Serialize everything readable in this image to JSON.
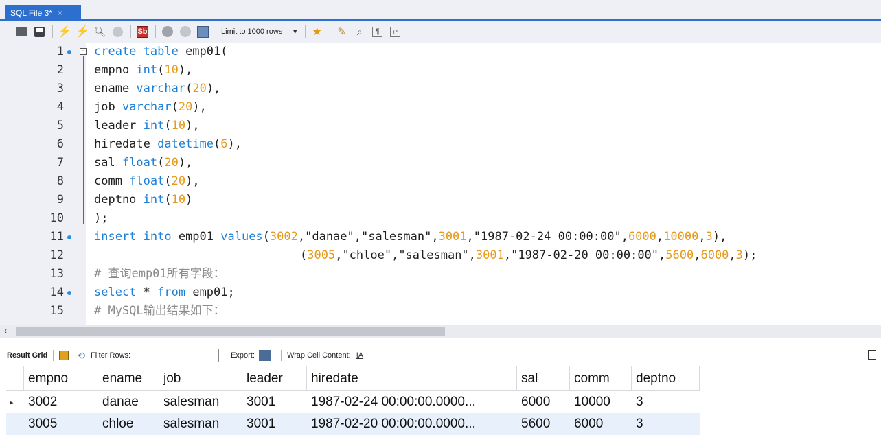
{
  "tab": {
    "title": "SQL File 3*",
    "close": "×"
  },
  "toolbar": {
    "limit_label": "Limit to 1000 rows",
    "buttons": [
      "open-file",
      "save",
      "execute",
      "execute-current",
      "explain",
      "stop",
      "toggle-autocommit",
      "commit",
      "rollback",
      "toggle-output",
      "add-snippet",
      "beautify",
      "find",
      "invisible-chars",
      "wrap"
    ]
  },
  "editor": {
    "lines": [
      {
        "n": "1",
        "marker": true,
        "fold": true
      },
      {
        "n": "2",
        "marker": false
      },
      {
        "n": "3",
        "marker": false
      },
      {
        "n": "4",
        "marker": false
      },
      {
        "n": "5",
        "marker": false
      },
      {
        "n": "6",
        "marker": false
      },
      {
        "n": "7",
        "marker": false
      },
      {
        "n": "8",
        "marker": false
      },
      {
        "n": "9",
        "marker": false
      },
      {
        "n": "10",
        "marker": false
      },
      {
        "n": "11",
        "marker": true
      },
      {
        "n": "12",
        "marker": false
      },
      {
        "n": "13",
        "marker": false
      },
      {
        "n": "14",
        "marker": true
      },
      {
        "n": "15",
        "marker": false
      }
    ],
    "code": {
      "l1_a": "create table",
      "l1_b": " emp01(",
      "l2_a": "empno ",
      "l2_b": "int",
      "l2_c": "(",
      "l2_d": "10",
      "l2_e": "),",
      "l3_a": "ename ",
      "l3_b": "varchar",
      "l3_c": "(",
      "l3_d": "20",
      "l3_e": "),",
      "l4_a": "job ",
      "l4_b": "varchar",
      "l4_c": "(",
      "l4_d": "20",
      "l4_e": "),",
      "l5_a": "leader ",
      "l5_b": "int",
      "l5_c": "(",
      "l5_d": "10",
      "l5_e": "),",
      "l6_a": "hiredate ",
      "l6_b": "datetime",
      "l6_c": "(",
      "l6_d": "6",
      "l6_e": "),",
      "l7_a": "sal ",
      "l7_b": "float",
      "l7_c": "(",
      "l7_d": "20",
      "l7_e": "),",
      "l8_a": "comm ",
      "l8_b": "float",
      "l8_c": "(",
      "l8_d": "20",
      "l8_e": "),",
      "l9_a": "deptno ",
      "l9_b": "int",
      "l9_c": "(",
      "l9_d": "10",
      "l9_e": ")",
      "l10": ");",
      "l11_a": "insert into",
      "l11_b": " emp01 ",
      "l11_c": "values",
      "l11_d": "(",
      "l11_e": "3002",
      "l11_f": ",\"danae\",\"salesman\",",
      "l11_g": "3001",
      "l11_h": ",\"1987-02-24 00:00:00\",",
      "l11_i": "6000",
      "l11_j": ",",
      "l11_k": "10000",
      "l11_l": ",",
      "l11_m": "3",
      "l11_n": "),",
      "l12_a": "(",
      "l12_b": "3005",
      "l12_c": ",\"chloe\",\"salesman\",",
      "l12_d": "3001",
      "l12_e": ",\"1987-02-20 00:00:00\",",
      "l12_f": "5600",
      "l12_g": ",",
      "l12_h": "6000",
      "l12_i": ",",
      "l12_j": "3",
      "l12_k": ");",
      "l13": "# 查询emp01所有字段：",
      "l14_a": "select",
      "l14_b": " * ",
      "l14_c": "from",
      "l14_d": " emp01;",
      "l15": "# MySQL输出结果如下："
    }
  },
  "scroll": {
    "left_arrow": "‹"
  },
  "result_toolbar": {
    "result_grid": "Result Grid",
    "filter_rows": "Filter Rows:",
    "filter_value": "",
    "export": "Export:",
    "wrap_cell": "Wrap Cell Content:",
    "wrap_icon": "IA"
  },
  "grid": {
    "columns": [
      "empno",
      "ename",
      "job",
      "leader",
      "hiredate",
      "sal",
      "comm",
      "deptno"
    ],
    "rows": [
      {
        "selector": "▸",
        "cells": [
          "3002",
          "danae",
          "salesman",
          "3001",
          "1987-02-24 00:00:00.0000...",
          "6000",
          "10000",
          "3"
        ]
      },
      {
        "selector": "",
        "cells": [
          "3005",
          "chloe",
          "salesman",
          "3001",
          "1987-02-20 00:00:00.0000...",
          "5600",
          "6000",
          "3"
        ]
      }
    ]
  },
  "colors": {
    "keyword": "#1d7fd6",
    "number": "#e69a1d",
    "comment": "#8b8b8b",
    "tab_accent": "#2c6fcf",
    "selected_row": "#e8f1fb"
  }
}
